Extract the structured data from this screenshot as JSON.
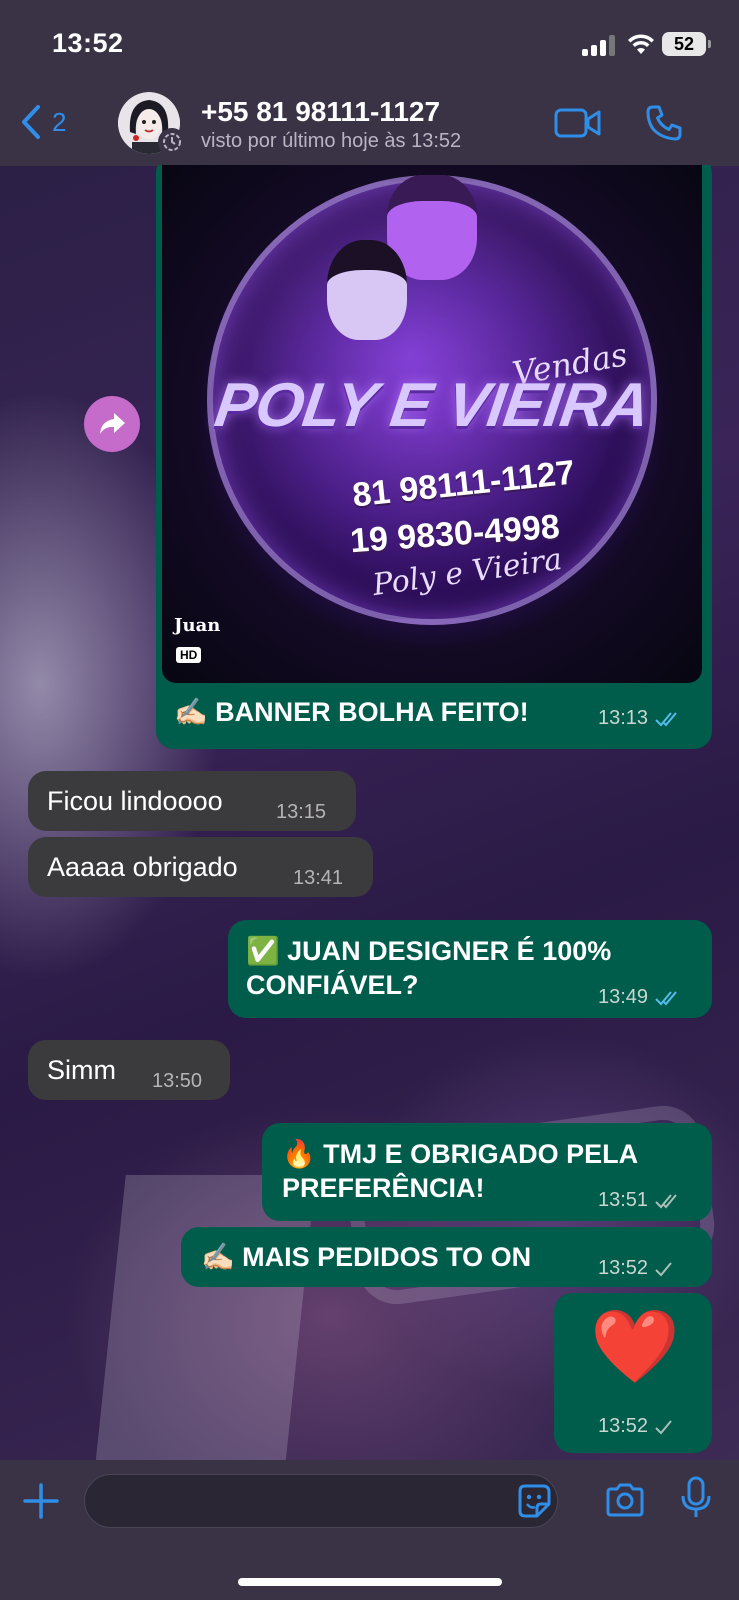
{
  "status_bar": {
    "time": "13:52",
    "battery": "52"
  },
  "header": {
    "back_count": "2",
    "contact_name": "+55 81 98111-1127",
    "contact_status": "visto por último hoje às 13:52"
  },
  "image_message": {
    "banner_title": "POLY E VIEIRA",
    "banner_subtitle": "Vendas",
    "banner_phone_1": "81 98111-1127",
    "banner_phone_2": "19 9830-4998",
    "banner_script": "Poly e Vieira",
    "banner_logo": "Juan",
    "hd_badge": "HD",
    "caption_emoji": "✍🏻",
    "caption": "BANNER BOLHA FEITO!",
    "time": "13:13"
  },
  "messages": [
    {
      "id": "m1",
      "direction": "in",
      "text": "Ficou lindoooo",
      "time": "13:15"
    },
    {
      "id": "m2",
      "direction": "in",
      "text": "Aaaaa obrigado",
      "time": "13:41"
    },
    {
      "id": "m3",
      "direction": "out",
      "emoji": "✅",
      "line1": "JUAN DESIGNER É 100%",
      "line2": "CONFIÁVEL?",
      "time": "13:49",
      "status": "read"
    },
    {
      "id": "m4",
      "direction": "in",
      "text": "Simm",
      "time": "13:50"
    },
    {
      "id": "m5",
      "direction": "out",
      "emoji": "🔥",
      "line1": "TMJ E OBRIGADO PELA",
      "line2": "PREFERÊNCIA!",
      "time": "13:51",
      "status": "delivered"
    },
    {
      "id": "m6",
      "direction": "out",
      "emoji": "✍🏻",
      "line1": "MAIS PEDIDOS TO ON",
      "time": "13:52",
      "status": "sent"
    },
    {
      "id": "m7",
      "direction": "out",
      "emoji": "❤️",
      "time": "13:52",
      "status": "sent"
    }
  ],
  "colors": {
    "outgoing_bubble": "#005c4b",
    "incoming_bubble": "#3b3a3d",
    "accent_blue": "#2f8ee8",
    "read_tick": "#53bdeb"
  },
  "icons": [
    "back-chevron-icon",
    "video-call-icon",
    "phone-icon",
    "forward-icon",
    "plus-icon",
    "sticker-icon",
    "camera-icon",
    "microphone-icon",
    "double-check-icon",
    "single-check-icon"
  ]
}
